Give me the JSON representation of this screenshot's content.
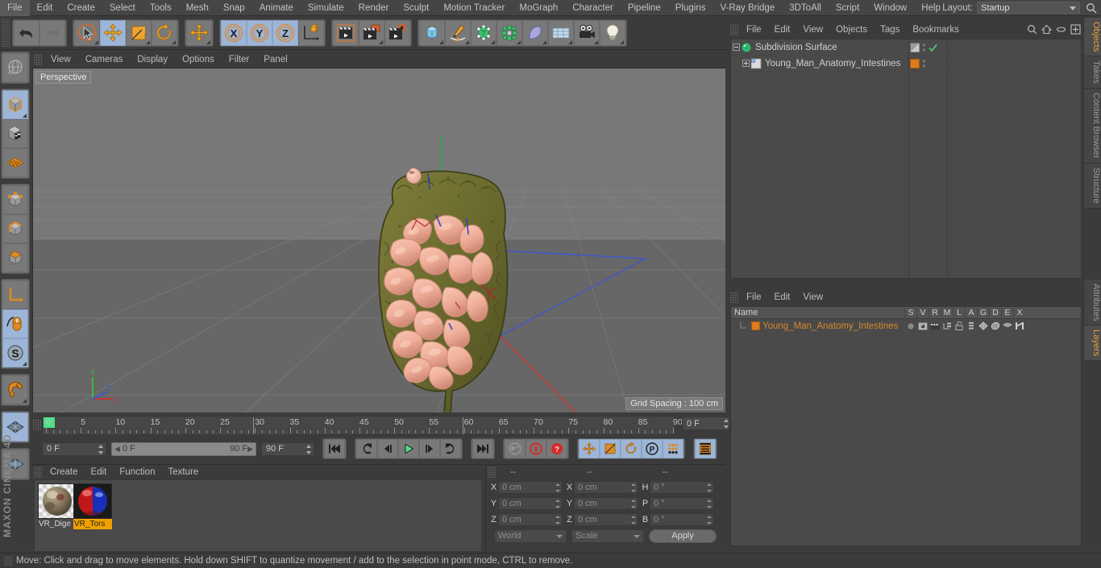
{
  "menubar": {
    "items": [
      "File",
      "Edit",
      "Create",
      "Select",
      "Tools",
      "Mesh",
      "Snap",
      "Animate",
      "Simulate",
      "Render",
      "Sculpt",
      "Motion Tracker",
      "MoGraph",
      "Character",
      "Pipeline",
      "Plugins",
      "V-Ray Bridge",
      "3DToAll",
      "Script",
      "Window",
      "Help"
    ],
    "layout_label": "Layout:",
    "layout_value": "Startup",
    "search_icon": "search-icon"
  },
  "toolbar": {
    "groups": [
      {
        "name": "undo-redo",
        "buttons": [
          {
            "icon": "undo-icon",
            "label": "Undo",
            "selected": false
          },
          {
            "icon": "redo-icon",
            "label": "Redo",
            "selected": false
          }
        ]
      },
      {
        "name": "transform-tools",
        "buttons": [
          {
            "icon": "live-selection-icon",
            "label": "Live Selection",
            "selected": false
          },
          {
            "icon": "move-icon",
            "label": "Move",
            "selected": true
          },
          {
            "icon": "scale-icon",
            "label": "Scale",
            "selected": false
          },
          {
            "icon": "rotate-icon",
            "label": "Rotate",
            "selected": false
          }
        ]
      },
      {
        "name": "move-standalone",
        "buttons": [
          {
            "icon": "move-icon",
            "label": "Move Tool",
            "selected": false
          }
        ]
      },
      {
        "name": "axis-locks",
        "buttons": [
          {
            "icon": "x-axis-icon",
            "label": "X Axis",
            "selected": true
          },
          {
            "icon": "y-axis-icon",
            "label": "Y Axis",
            "selected": true
          },
          {
            "icon": "z-axis-icon",
            "label": "Z Axis",
            "selected": true
          },
          {
            "icon": "world-coordinate-icon",
            "label": "World/Object Coordinate",
            "selected": false
          }
        ]
      },
      {
        "name": "render-group",
        "buttons": [
          {
            "icon": "render-view-icon",
            "label": "Render View",
            "selected": false
          },
          {
            "icon": "render-region-icon",
            "label": "Render to Picture Viewer",
            "selected": false
          },
          {
            "icon": "render-settings-icon",
            "label": "Edit Render Settings",
            "selected": false
          }
        ]
      },
      {
        "name": "object-group",
        "buttons": [
          {
            "icon": "cube-icon",
            "label": "Add Cube Object",
            "selected": false
          },
          {
            "icon": "pen-spline-icon",
            "label": "Add Spline",
            "selected": false
          },
          {
            "icon": "nurbs-icon",
            "label": "Add Generator Object",
            "selected": false
          },
          {
            "icon": "array-icon",
            "label": "Add Modeling Object",
            "selected": false
          },
          {
            "icon": "deformer-icon",
            "label": "Add Bend Object",
            "selected": false
          },
          {
            "icon": "environment-icon",
            "label": "Add Environment Object",
            "selected": false
          },
          {
            "icon": "camera-icon",
            "label": "Add Camera Object",
            "selected": false
          },
          {
            "icon": "light-icon",
            "label": "Add Light Object",
            "selected": false
          }
        ]
      }
    ]
  },
  "left_toolbar": {
    "groups": [
      {
        "buttons": [
          {
            "icon": "undo-view-icon",
            "label": "Undo View",
            "selected": false
          }
        ]
      },
      {
        "buttons": [
          {
            "icon": "model-mode-icon",
            "label": "Model Mode",
            "selected": true
          },
          {
            "icon": "texture-mode-icon",
            "label": "Texture Mode",
            "selected": false
          },
          {
            "icon": "workplane-icon",
            "label": "Workplane",
            "selected": false
          }
        ]
      },
      {
        "buttons": [
          {
            "icon": "points-mode-icon",
            "label": "Points Mode",
            "selected": false
          },
          {
            "icon": "edges-mode-icon",
            "label": "Edges Mode",
            "selected": false
          },
          {
            "icon": "polygons-mode-icon",
            "label": "Polygons Mode",
            "selected": false
          }
        ]
      },
      {
        "buttons": [
          {
            "icon": "axis-modify-icon",
            "label": "Enable Axis Modification",
            "selected": false
          },
          {
            "icon": "viewport-solo-icon",
            "label": "Viewport Solo Single",
            "selected": true
          },
          {
            "icon": "soft-selection-icon",
            "label": "Enable Snapping",
            "selected": true
          }
        ]
      },
      {
        "buttons": [
          {
            "icon": "magnet-icon",
            "label": "Magnet",
            "selected": false
          }
        ]
      },
      {
        "buttons": [
          {
            "icon": "grid-icon",
            "label": "Workplane Grid",
            "selected": true
          }
        ]
      }
    ],
    "brand": "MAXON CINEMA 4D"
  },
  "viewport": {
    "menu": [
      "View",
      "Cameras",
      "Display",
      "Options",
      "Filter",
      "Panel"
    ],
    "perspective_label": "Perspective",
    "grid_spacing": "Grid Spacing : 100 cm",
    "axis_labels": {
      "x": "X",
      "y": "Y",
      "z": "Z"
    },
    "axis_colors": {
      "x": "#d03030",
      "y": "#36c436",
      "z": "#3a55d8"
    }
  },
  "timeline": {
    "ticks": [
      {
        "label": "0",
        "value": 0
      },
      {
        "label": "5",
        "value": 5
      },
      {
        "label": "10",
        "value": 10
      },
      {
        "label": "15",
        "value": 15
      },
      {
        "label": "20",
        "value": 20
      },
      {
        "label": "25",
        "value": 25
      },
      {
        "label": "30",
        "value": 30
      },
      {
        "label": "35",
        "value": 35
      },
      {
        "label": "40",
        "value": 40
      },
      {
        "label": "45",
        "value": 45
      },
      {
        "label": "50",
        "value": 50
      },
      {
        "label": "55",
        "value": 55
      },
      {
        "label": "60",
        "value": 60
      },
      {
        "label": "65",
        "value": 65
      },
      {
        "label": "70",
        "value": 70
      },
      {
        "label": "75",
        "value": 75
      },
      {
        "label": "80",
        "value": 80
      },
      {
        "label": "85",
        "value": 85
      },
      {
        "label": "90",
        "value": 90
      }
    ],
    "range_start": 0,
    "range_end": 90,
    "current_frame_right": "0 F",
    "current_frame": "0 F",
    "range_min_label": "0 F",
    "range_max_label": "90 F",
    "max_frame": "90 F",
    "playhead_color": "#4fe08a",
    "transport": [
      {
        "icon": "go-to-start-icon",
        "label": "Go to Start"
      },
      {
        "icon": "previous-key-icon",
        "label": "Go to Previous Key"
      },
      {
        "icon": "step-back-icon",
        "label": "Go to Previous Frame"
      },
      {
        "icon": "play-icon",
        "label": "Play Forwards"
      },
      {
        "icon": "step-forward-icon",
        "label": "Go to Next Frame"
      },
      {
        "icon": "next-key-icon",
        "label": "Go to Next Key"
      },
      {
        "icon": "go-to-end-icon",
        "label": "Go to End"
      }
    ],
    "record_group": [
      {
        "icon": "autokey-icon",
        "label": "Autokeying",
        "active": false
      },
      {
        "icon": "record-icon",
        "label": "Record Active Objects",
        "active": true
      },
      {
        "icon": "keyframe-selection-icon",
        "label": "Keyframe Selection",
        "active": true
      }
    ],
    "param_group": [
      {
        "icon": "position-key-icon",
        "label": "Position",
        "selected": true
      },
      {
        "icon": "scale-key-icon",
        "label": "Scale",
        "selected": true
      },
      {
        "icon": "rotation-key-icon",
        "label": "Rotation",
        "selected": true
      },
      {
        "icon": "param-key-icon",
        "label": "Parameter",
        "selected": true
      },
      {
        "icon": "pla-key-icon",
        "label": "Point Level Animation",
        "selected": true
      }
    ],
    "dope_button": {
      "icon": "dope-sheet-icon",
      "label": "Animation Mode"
    }
  },
  "material_manager": {
    "menu": [
      "Create",
      "Edit",
      "Function",
      "Texture"
    ],
    "materials": [
      {
        "name": "VR_Dige",
        "selected": false,
        "type": "textured"
      },
      {
        "name": "VR_Tors",
        "selected": true,
        "type": "redblue"
      }
    ]
  },
  "coordinate_manager": {
    "headers": [
      "--",
      "--",
      "--"
    ],
    "rows": [
      {
        "label_pos": "X",
        "value_pos": "0 cm",
        "label_size": "X",
        "value_size": "0 cm",
        "label_rot": "H",
        "value_rot": "0 °"
      },
      {
        "label_pos": "Y",
        "value_pos": "0 cm",
        "label_size": "Y",
        "value_size": "0 cm",
        "label_rot": "P",
        "value_rot": "0 °"
      },
      {
        "label_pos": "Z",
        "value_pos": "0 cm",
        "label_size": "Z",
        "value_size": "0 cm",
        "label_rot": "B",
        "value_rot": "0 °"
      }
    ],
    "system_dropdown": "World",
    "mode_dropdown": "Scale",
    "apply_label": "Apply"
  },
  "object_manager": {
    "menu": [
      "File",
      "Edit",
      "View",
      "Objects",
      "Tags",
      "Bookmarks"
    ],
    "header_icons": [
      "search-icon",
      "home-icon",
      "ellipse-icon",
      "new-window-icon"
    ],
    "rows": [
      {
        "name": "Subdivision Surface",
        "indent": 0,
        "icon": "subdivision-surface-icon",
        "icon_color": "#3fcf84",
        "expander": "minus",
        "tag_swatch": "#9a9a9a",
        "tag_type": "visibility-dots",
        "check": true,
        "name_color": "#cfcfcf"
      },
      {
        "name": "Young_Man_Anatomy_Intestines",
        "indent": 1,
        "icon": "polygon-object-icon",
        "icon_color": "#d8d8d8",
        "expander": "plus",
        "tag_swatch": "#e07a1c",
        "tag_type": "material-tag",
        "check": false,
        "name_color": "#cfcfcf"
      }
    ]
  },
  "layer_manager": {
    "menu": [
      "File",
      "Edit",
      "View"
    ],
    "columns": [
      "Name",
      "S",
      "V",
      "R",
      "M",
      "L",
      "A",
      "G",
      "D",
      "E",
      "X"
    ],
    "rows": [
      {
        "name": "Young_Man_Anatomy_Intestines",
        "color": "#e07a1c",
        "cells": [
          "solo-dot",
          "view-icon",
          "render-icon",
          "manager-icon",
          "lock-icon",
          "animation-icon",
          "generator-icon",
          "deformer-icon",
          "expression-icon",
          "xref-icon"
        ]
      }
    ]
  },
  "right_tabs": [
    {
      "label": "Objects",
      "active": true
    },
    {
      "label": "Takes",
      "active": false
    },
    {
      "label": "Content Browser",
      "active": false
    },
    {
      "label": "Structure",
      "active": false
    },
    {
      "label": "Attributes",
      "active": false
    },
    {
      "label": "Layers",
      "active": true
    }
  ],
  "statusbar": {
    "text": "Move: Click and drag to move elements. Hold down SHIFT to quantize movement / add to the selection in point mode, CTRL to remove."
  }
}
